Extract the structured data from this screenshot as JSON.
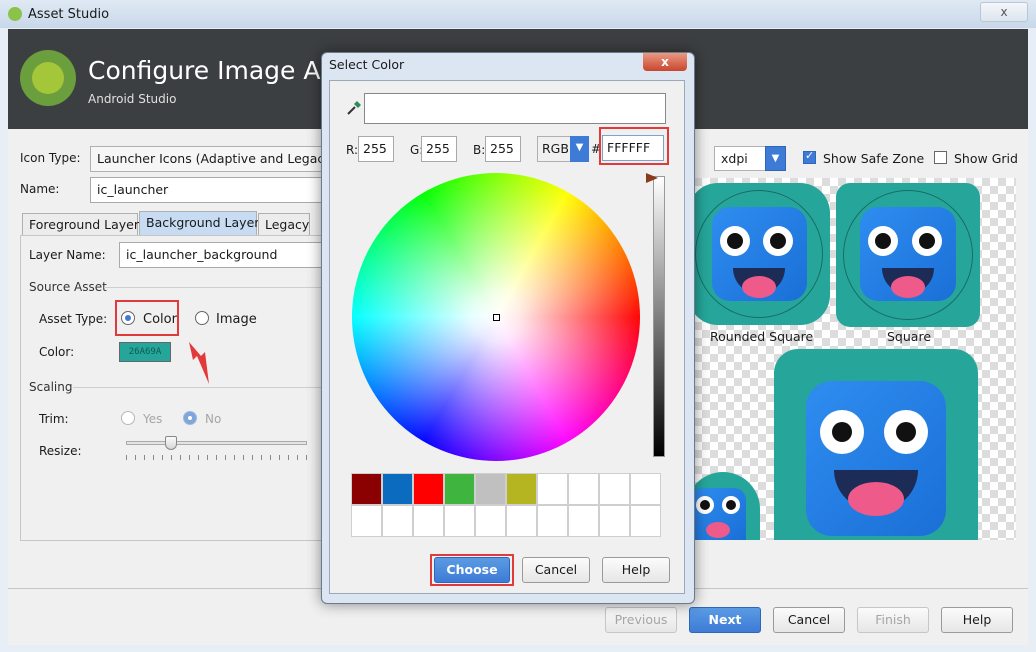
{
  "window": {
    "title": "Asset Studio",
    "close_label": "x"
  },
  "header": {
    "title": "Configure Image Asset",
    "subtitle": "Android Studio"
  },
  "form": {
    "icon_type_label": "Icon Type:",
    "icon_type_value": "Launcher Icons (Adaptive and Legacy)",
    "name_label": "Name:",
    "name_value": "ic_launcher",
    "tabs": [
      {
        "label": "Foreground Layer"
      },
      {
        "label": "Background Layer"
      },
      {
        "label": "Legacy"
      }
    ],
    "layer_name_label": "Layer Name:",
    "layer_name_value": "ic_launcher_background",
    "source_asset_label": "Source Asset",
    "asset_type_label": "Asset Type:",
    "asset_type_options": [
      {
        "label": "Color",
        "selected": true
      },
      {
        "label": "Image",
        "selected": false
      }
    ],
    "color_label": "Color:",
    "color_value": "26A69A",
    "scaling_label": "Scaling",
    "trim_label": "Trim:",
    "trim_options": [
      {
        "label": "Yes",
        "selected": false
      },
      {
        "label": "No",
        "selected": true
      }
    ],
    "resize_label": "Resize:",
    "resize_percent": 25
  },
  "preview": {
    "density": "xdpi",
    "show_safe_zone_label": "Show Safe Zone",
    "show_safe_zone": true,
    "show_grid_label": "Show Grid",
    "show_grid": false,
    "captions": [
      "Rounded Square",
      "Square"
    ],
    "background_color": "#26a69a"
  },
  "footer": {
    "previous": "Previous",
    "next": "Next",
    "cancel": "Cancel",
    "finish": "Finish",
    "help": "Help"
  },
  "color_dialog": {
    "title": "Select Color",
    "close_label": "x",
    "r_label": "R:",
    "r_value": "255",
    "g_label": "G:",
    "g_value": "255",
    "b_label": "B:",
    "b_value": "255",
    "mode": "RGB",
    "hash_label": "#",
    "hex_value": "FFFFFF",
    "swatches": [
      "#8b0000",
      "#0b6bbf",
      "#ff0000",
      "#3fb53f",
      "#c0c0c0",
      "#b5b522"
    ],
    "choose": "Choose",
    "cancel": "Cancel",
    "help": "Help"
  }
}
